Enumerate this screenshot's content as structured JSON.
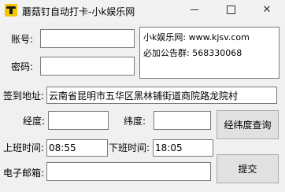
{
  "window": {
    "title": "蘑菇钉自动打卡-小k娱乐网",
    "minimize_label": "",
    "maximize_label": "",
    "close_label": "✕"
  },
  "form": {
    "account_label": "账号:",
    "account_value": "",
    "password_label": "密码:",
    "password_value": "",
    "address_label": "签到地址:",
    "address_value": "云南省昆明市五华区黑林铺街道商院路龙院村",
    "longitude_label": "经度:",
    "longitude_value": "",
    "latitude_label": "纬度:",
    "latitude_value": "",
    "checkin_time_label": "上班时间:",
    "checkin_time_value": "08:55",
    "checkout_time_label": "下班时间:",
    "checkout_time_value": "18:05",
    "email_label": "电子邮箱:",
    "email_value": ""
  },
  "info": {
    "line1": "小k娱乐网: www.kjsv.com",
    "line2": "必加公告群: 568330068"
  },
  "buttons": {
    "query_coords": "经纬度查询",
    "submit": "提交"
  }
}
